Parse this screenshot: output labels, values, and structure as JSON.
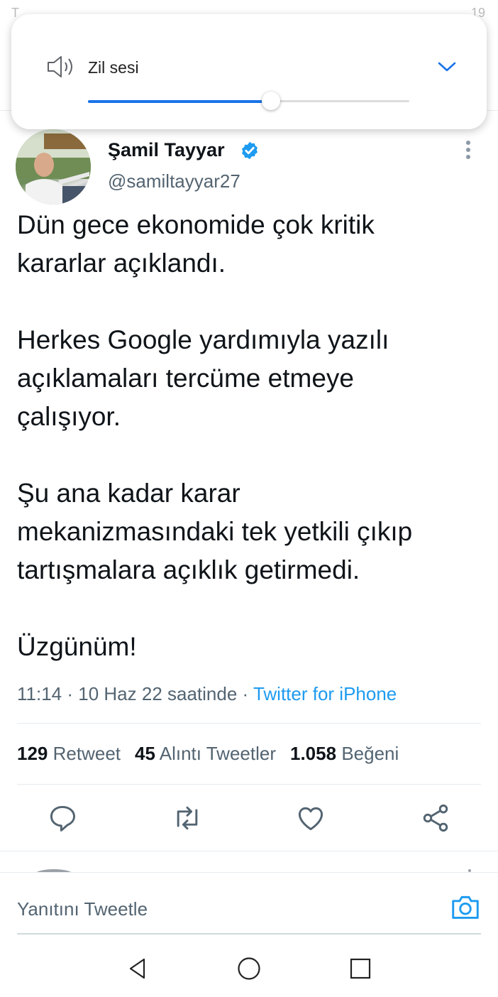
{
  "status_bar": {
    "left_text": "T ... ",
    "right_text": "19"
  },
  "volume": {
    "label": "Zil sesi",
    "level": 0.57,
    "accent": "#1a73e8",
    "icons": {
      "speaker": "speaker-icon",
      "expand": "chevron-down-icon"
    }
  },
  "tweet": {
    "author_name": "Şamil Tayyar",
    "handle": "@samiltayyar27",
    "verified": true,
    "text": "Dün gece ekonomide çok kritik\nkararlar açıklandı.\n\nHerkes Google yardımıyla yazılı\naçıklamaları tercüme etmeye\nçalışıyor.\n\nŞu ana kadar karar\nmekanizmasındaki tek yetkili çıkıp\ntartışmalara açıklık getirmedi.\n\n Üzgünüm!",
    "time": "11:14",
    "date": "10 Haz 22 saatinde",
    "source": "Twitter for iPhone",
    "stats": [
      {
        "count": "129",
        "label": "Retweet"
      },
      {
        "count": "45",
        "label": "Alıntı Tweetler"
      },
      {
        "count": "1.058",
        "label": "Beğeni"
      }
    ],
    "actions": [
      "reply-icon",
      "retweet-icon",
      "like-icon",
      "share-icon"
    ]
  },
  "reply": {
    "placeholder": "Yanıtını Tweetle"
  },
  "colors": {
    "link": "#1d9bf0",
    "secondary_text": "#536471",
    "verified": "#1d9bf0"
  }
}
